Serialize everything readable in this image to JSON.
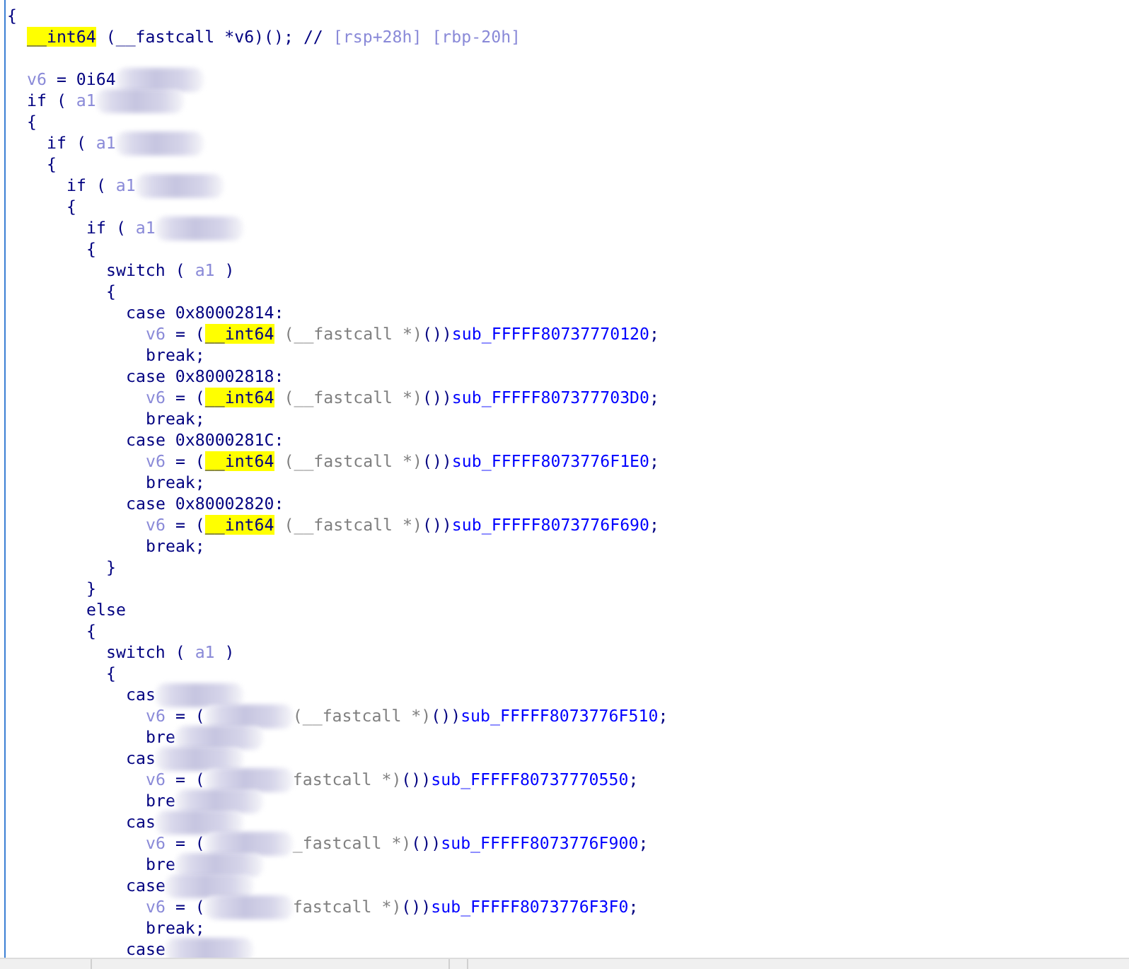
{
  "code": [
    {
      "kind": "code",
      "tokens": [
        {
          "kind": "text",
          "text": "{"
        }
      ],
      "children": [
        {
          "kind": "code",
          "tokens": [
            {
              "kind": "type",
              "text": "__int64"
            },
            {
              "kind": "text",
              "text": " (__fastcall *v6)(); // "
            },
            {
              "kind": "comment",
              "text": "[rsp+28h] [rbp-20h]"
            }
          ]
        },
        {
          "kind": "blank"
        },
        {
          "kind": "code",
          "tokens": [
            {
              "kind": "var",
              "text": "v6"
            },
            {
              "kind": "text",
              "text": " = 0i64"
            },
            {
              "kind": "redacted"
            }
          ]
        },
        {
          "kind": "code",
          "tokens": [
            {
              "kind": "text",
              "text": "if ( "
            },
            {
              "kind": "var",
              "text": "a1"
            },
            {
              "kind": "redacted"
            }
          ]
        },
        {
          "kind": "code",
          "tokens": [
            {
              "kind": "text",
              "text": "{"
            }
          ],
          "children": [
            {
              "kind": "code",
              "tokens": [
                {
                  "kind": "text",
                  "text": "if ( "
                },
                {
                  "kind": "var",
                  "text": "a1"
                },
                {
                  "kind": "redacted"
                }
              ]
            },
            {
              "kind": "code",
              "tokens": [
                {
                  "kind": "text",
                  "text": "{"
                }
              ],
              "children": [
                {
                  "kind": "code",
                  "tokens": [
                    {
                      "kind": "text",
                      "text": "if ( "
                    },
                    {
                      "kind": "var",
                      "text": "a1"
                    },
                    {
                      "kind": "redacted"
                    }
                  ]
                },
                {
                  "kind": "code",
                  "tokens": [
                    {
                      "kind": "text",
                      "text": "{"
                    }
                  ],
                  "children": [
                    {
                      "kind": "code",
                      "tokens": [
                        {
                          "kind": "text",
                          "text": "if ( "
                        },
                        {
                          "kind": "var",
                          "text": "a1"
                        },
                        {
                          "kind": "redacted"
                        }
                      ]
                    },
                    {
                      "kind": "code",
                      "tokens": [
                        {
                          "kind": "text",
                          "text": "{"
                        }
                      ],
                      "children": [
                        {
                          "kind": "code",
                          "tokens": [
                            {
                              "kind": "text",
                              "text": "switch ( "
                            },
                            {
                              "kind": "var",
                              "text": "a1"
                            },
                            {
                              "kind": "text",
                              "text": " )"
                            }
                          ]
                        },
                        {
                          "kind": "code",
                          "tokens": [
                            {
                              "kind": "text",
                              "text": "{"
                            }
                          ],
                          "children": [
                            {
                              "kind": "code",
                              "tokens": [
                                {
                                  "kind": "text",
                                  "text": "case 0x80002814:"
                                }
                              ],
                              "children": [
                                {
                                  "kind": "code",
                                  "tokens": [
                                    {
                                      "kind": "var",
                                      "text": "v6"
                                    },
                                    {
                                      "kind": "text",
                                      "text": " = ("
                                    },
                                    {
                                      "kind": "type",
                                      "text": "__int64"
                                    },
                                    {
                                      "kind": "cast",
                                      "text": " (__fastcall *)"
                                    },
                                    {
                                      "kind": "text",
                                      "text": "())"
                                    },
                                    {
                                      "kind": "func",
                                      "text": "sub_FFFFF80737770120"
                                    },
                                    {
                                      "kind": "text",
                                      "text": ";"
                                    }
                                  ]
                                },
                                {
                                  "kind": "code",
                                  "tokens": [
                                    {
                                      "kind": "text",
                                      "text": "break;"
                                    }
                                  ]
                                }
                              ]
                            },
                            {
                              "kind": "code",
                              "tokens": [
                                {
                                  "kind": "text",
                                  "text": "case 0x80002818:"
                                }
                              ],
                              "children": [
                                {
                                  "kind": "code",
                                  "tokens": [
                                    {
                                      "kind": "var",
                                      "text": "v6"
                                    },
                                    {
                                      "kind": "text",
                                      "text": " = ("
                                    },
                                    {
                                      "kind": "type",
                                      "text": "__int64"
                                    },
                                    {
                                      "kind": "cast",
                                      "text": " (__fastcall *)"
                                    },
                                    {
                                      "kind": "text",
                                      "text": "())"
                                    },
                                    {
                                      "kind": "func",
                                      "text": "sub_FFFFF807377703D0"
                                    },
                                    {
                                      "kind": "text",
                                      "text": ";"
                                    }
                                  ]
                                },
                                {
                                  "kind": "code",
                                  "tokens": [
                                    {
                                      "kind": "text",
                                      "text": "break;"
                                    }
                                  ]
                                }
                              ]
                            },
                            {
                              "kind": "code",
                              "tokens": [
                                {
                                  "kind": "text",
                                  "text": "case 0x8000281C:"
                                }
                              ],
                              "children": [
                                {
                                  "kind": "code",
                                  "tokens": [
                                    {
                                      "kind": "var",
                                      "text": "v6"
                                    },
                                    {
                                      "kind": "text",
                                      "text": " = ("
                                    },
                                    {
                                      "kind": "type",
                                      "text": "__int64"
                                    },
                                    {
                                      "kind": "cast",
                                      "text": " (__fastcall *)"
                                    },
                                    {
                                      "kind": "text",
                                      "text": "())"
                                    },
                                    {
                                      "kind": "func",
                                      "text": "sub_FFFFF8073776F1E0"
                                    },
                                    {
                                      "kind": "text",
                                      "text": ";"
                                    }
                                  ]
                                },
                                {
                                  "kind": "code",
                                  "tokens": [
                                    {
                                      "kind": "text",
                                      "text": "break;"
                                    }
                                  ]
                                }
                              ]
                            },
                            {
                              "kind": "code",
                              "tokens": [
                                {
                                  "kind": "text",
                                  "text": "case 0x80002820:"
                                }
                              ],
                              "children": [
                                {
                                  "kind": "code",
                                  "tokens": [
                                    {
                                      "kind": "var",
                                      "text": "v6"
                                    },
                                    {
                                      "kind": "text",
                                      "text": " = ("
                                    },
                                    {
                                      "kind": "type",
                                      "text": "__int64"
                                    },
                                    {
                                      "kind": "cast",
                                      "text": " (__fastcall *)"
                                    },
                                    {
                                      "kind": "text",
                                      "text": "())"
                                    },
                                    {
                                      "kind": "func",
                                      "text": "sub_FFFFF8073776F690"
                                    },
                                    {
                                      "kind": "text",
                                      "text": ";"
                                    }
                                  ]
                                },
                                {
                                  "kind": "code",
                                  "tokens": [
                                    {
                                      "kind": "text",
                                      "text": "break;"
                                    }
                                  ]
                                }
                              ]
                            }
                          ]
                        },
                        {
                          "kind": "code",
                          "tokens": [
                            {
                              "kind": "text",
                              "text": "}"
                            }
                          ]
                        }
                      ]
                    },
                    {
                      "kind": "code",
                      "tokens": [
                        {
                          "kind": "text",
                          "text": "}"
                        }
                      ]
                    },
                    {
                      "kind": "code",
                      "tokens": [
                        {
                          "kind": "text",
                          "text": "else"
                        }
                      ]
                    },
                    {
                      "kind": "code",
                      "tokens": [
                        {
                          "kind": "text",
                          "text": "{"
                        }
                      ],
                      "children": [
                        {
                          "kind": "code",
                          "tokens": [
                            {
                              "kind": "text",
                              "text": "switch ( "
                            },
                            {
                              "kind": "var",
                              "text": "a1"
                            },
                            {
                              "kind": "text",
                              "text": " )"
                            }
                          ]
                        },
                        {
                          "kind": "code",
                          "tokens": [
                            {
                              "kind": "text",
                              "text": "{"
                            }
                          ],
                          "children": [
                            {
                              "kind": "code",
                              "tokens": [
                                {
                                  "kind": "text",
                                  "text": "cas"
                                },
                                {
                                  "kind": "redacted"
                                }
                              ],
                              "children": [
                                {
                                  "kind": "code",
                                  "tokens": [
                                    {
                                      "kind": "var",
                                      "text": "v6"
                                    },
                                    {
                                      "kind": "text",
                                      "text": " = ("
                                    },
                                    {
                                      "kind": "redacted"
                                    },
                                    {
                                      "kind": "cast",
                                      "text": "(__fastcall *)"
                                    },
                                    {
                                      "kind": "text",
                                      "text": "())"
                                    },
                                    {
                                      "kind": "func",
                                      "text": "sub_FFFFF8073776F510"
                                    },
                                    {
                                      "kind": "text",
                                      "text": ";"
                                    }
                                  ]
                                },
                                {
                                  "kind": "code",
                                  "tokens": [
                                    {
                                      "kind": "text",
                                      "text": "bre"
                                    },
                                    {
                                      "kind": "redacted"
                                    }
                                  ]
                                }
                              ]
                            },
                            {
                              "kind": "code",
                              "tokens": [
                                {
                                  "kind": "text",
                                  "text": "cas"
                                },
                                {
                                  "kind": "redacted"
                                }
                              ],
                              "children": [
                                {
                                  "kind": "code",
                                  "tokens": [
                                    {
                                      "kind": "var",
                                      "text": "v6"
                                    },
                                    {
                                      "kind": "text",
                                      "text": " = ("
                                    },
                                    {
                                      "kind": "redacted"
                                    },
                                    {
                                      "kind": "cast",
                                      "text": "fastcall *)"
                                    },
                                    {
                                      "kind": "text",
                                      "text": "())"
                                    },
                                    {
                                      "kind": "func",
                                      "text": "sub_FFFFF80737770550"
                                    },
                                    {
                                      "kind": "text",
                                      "text": ";"
                                    }
                                  ]
                                },
                                {
                                  "kind": "code",
                                  "tokens": [
                                    {
                                      "kind": "text",
                                      "text": "bre"
                                    },
                                    {
                                      "kind": "redacted"
                                    }
                                  ]
                                }
                              ]
                            },
                            {
                              "kind": "code",
                              "tokens": [
                                {
                                  "kind": "text",
                                  "text": "cas"
                                },
                                {
                                  "kind": "redacted"
                                }
                              ],
                              "children": [
                                {
                                  "kind": "code",
                                  "tokens": [
                                    {
                                      "kind": "var",
                                      "text": "v6"
                                    },
                                    {
                                      "kind": "text",
                                      "text": " = ("
                                    },
                                    {
                                      "kind": "redacted"
                                    },
                                    {
                                      "kind": "cast",
                                      "text": "_fastcall *)"
                                    },
                                    {
                                      "kind": "text",
                                      "text": "())"
                                    },
                                    {
                                      "kind": "func",
                                      "text": "sub_FFFFF8073776F900"
                                    },
                                    {
                                      "kind": "text",
                                      "text": ";"
                                    }
                                  ]
                                },
                                {
                                  "kind": "code",
                                  "tokens": [
                                    {
                                      "kind": "text",
                                      "text": "bre"
                                    },
                                    {
                                      "kind": "redacted"
                                    }
                                  ]
                                }
                              ]
                            },
                            {
                              "kind": "code",
                              "tokens": [
                                {
                                  "kind": "text",
                                  "text": "case"
                                },
                                {
                                  "kind": "redacted"
                                }
                              ],
                              "children": [
                                {
                                  "kind": "code",
                                  "tokens": [
                                    {
                                      "kind": "var",
                                      "text": "v6"
                                    },
                                    {
                                      "kind": "text",
                                      "text": " = ("
                                    },
                                    {
                                      "kind": "redacted"
                                    },
                                    {
                                      "kind": "cast",
                                      "text": "fastcall *)"
                                    },
                                    {
                                      "kind": "text",
                                      "text": "())"
                                    },
                                    {
                                      "kind": "func",
                                      "text": "sub_FFFFF8073776F3F0"
                                    },
                                    {
                                      "kind": "text",
                                      "text": ";"
                                    }
                                  ]
                                },
                                {
                                  "kind": "code",
                                  "tokens": [
                                    {
                                      "kind": "text",
                                      "text": "break;"
                                    }
                                  ]
                                }
                              ]
                            },
                            {
                              "kind": "code",
                              "tokens": [
                                {
                                  "kind": "text",
                                  "text": "case"
                                },
                                {
                                  "kind": "redacted"
                                }
                              ]
                            }
                          ]
                        }
                      ]
                    }
                  ]
                }
              ]
            }
          ]
        }
      ]
    }
  ]
}
